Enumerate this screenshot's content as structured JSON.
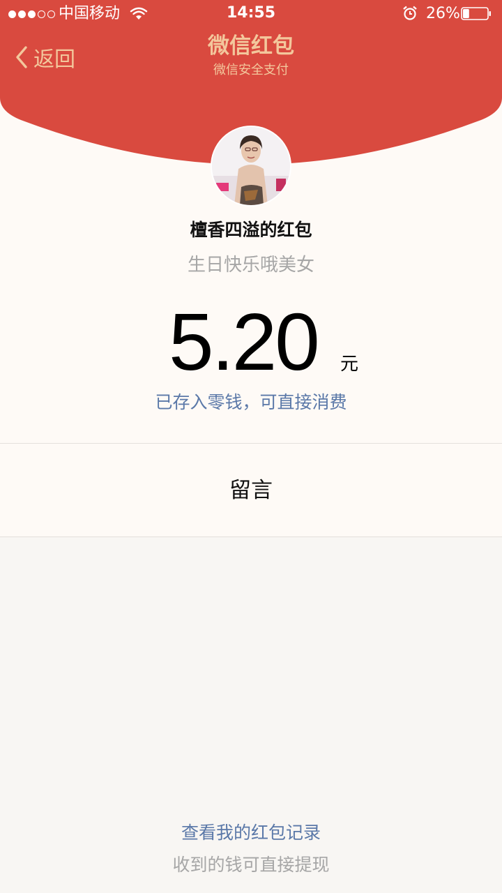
{
  "status_bar": {
    "carrier": "中国移动",
    "time": "14:55",
    "battery": "26%",
    "battery_level": 0.26,
    "signal_strength": 3,
    "signal_max": 5
  },
  "nav": {
    "back_label": "返回",
    "title": "微信红包",
    "subtitle": "微信安全支付"
  },
  "envelope": {
    "sender": "檀香四溢的红包",
    "greeting": "生日快乐哦美女",
    "amount": "5.20",
    "unit": "元",
    "deposit_note": "已存入零钱，可直接消费"
  },
  "message": {
    "label": "留言"
  },
  "footer": {
    "records_link": "查看我的红包记录",
    "withdraw_note": "收到的钱可直接提现"
  },
  "colors": {
    "header_red": "#d94a3f",
    "accent_gold": "#f3c79c",
    "link_blue": "#5a78a8",
    "muted_gray": "#a6a6a6"
  },
  "icons": [
    "back-chevron-icon",
    "wifi-icon",
    "alarm-icon",
    "battery-icon",
    "signal-dots-icon"
  ]
}
